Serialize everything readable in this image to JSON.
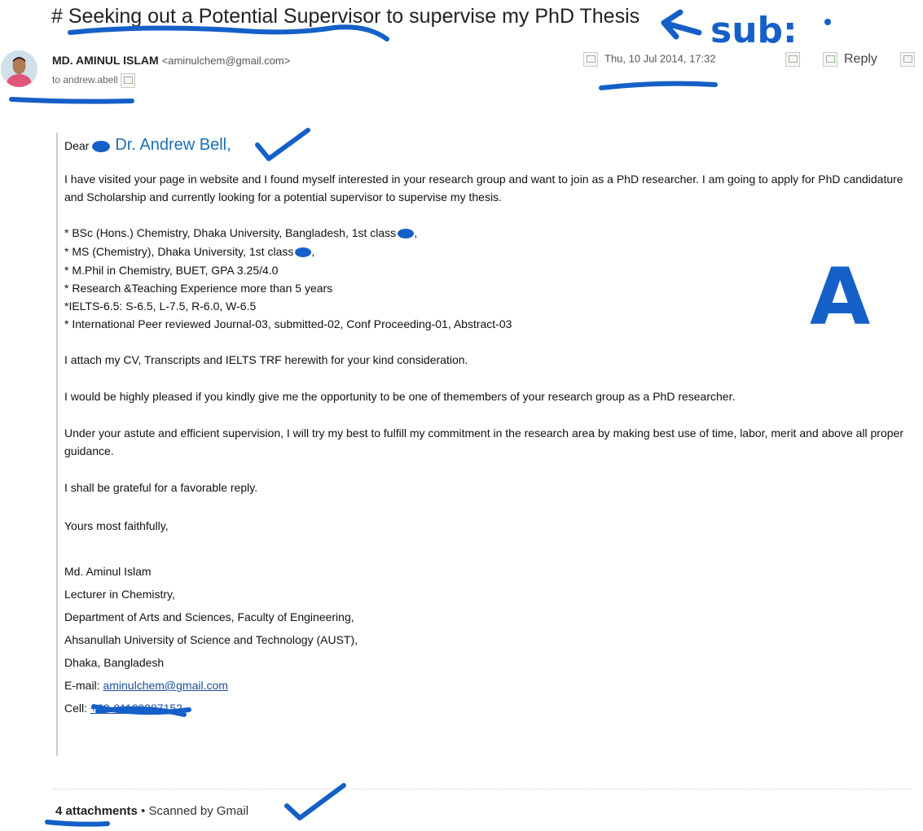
{
  "email": {
    "subject": "# Seeking out a Potential Supervisor to supervise my PhD Thesis",
    "sender_name": "MD. AMINUL ISLAM",
    "sender_email": "<aminulchem@gmail.com>",
    "recipient": "to andrew.abell",
    "date": "Thu, 10 Jul 2014, 17:32",
    "reply_label": "Reply"
  },
  "greeting": {
    "dear": "Dear",
    "name": "Dr. Andrew Bell,"
  },
  "body": {
    "intro": "I have visited your page in website and I found myself interested in your research group and want to join as a PhD researcher. I am going to apply for PhD candidature and Scholarship and currently looking for a potential supervisor to supervise my thesis.",
    "credentials": [
      "* BSc (Hons.) Chemistry, Dhaka University, Bangladesh, 1st class",
      "* MS (Chemistry), Dhaka University, 1st class",
      "* M.Phil in Chemistry, BUET, GPA 3.25/4.0",
      "* Research &Teaching Experience more than 5 years",
      "*IELTS-6.5: S-6.5, L-7.5, R-6.0, W-6.5",
      "* International Peer reviewed Journal-03, submitted-02, Conf Proceeding-01, Abstract-03"
    ],
    "attach_note": "I attach my CV, Transcripts and IELTS TRF herewith for your kind consideration.",
    "pleased": "I would be highly pleased if you kindly give me the opportunity to be one of themembers of your research group as a PhD researcher.",
    "supervision": "Under your astute and efficient supervision, I will try my best to fulfill my commitment in the research area by making best use of time, labor, merit and above all proper guidance.",
    "grateful": " I shall be grateful for a favorable reply.",
    "closing": "Yours most faithfully,"
  },
  "signature": {
    "name": "Md. Aminul Islam",
    "title": "Lecturer in Chemistry,",
    "department": " Department of Arts and Sciences, Faculty of Engineering,",
    "university": "Ahsanullah University of Science and Technology (AUST),",
    "city": " Dhaka, Bangladesh",
    "email_label": "E-mail:",
    "email": "aminulchem@gmail.com",
    "cell_label": "Cell:",
    "cell": "+88-01190387152"
  },
  "attachments": {
    "count_label": "4 attachments",
    "scanned": "• Scanned by Gmail"
  },
  "annotations": {
    "sub_label": "sub:",
    "section_label": "A",
    "ink_color": "#1560c8"
  }
}
